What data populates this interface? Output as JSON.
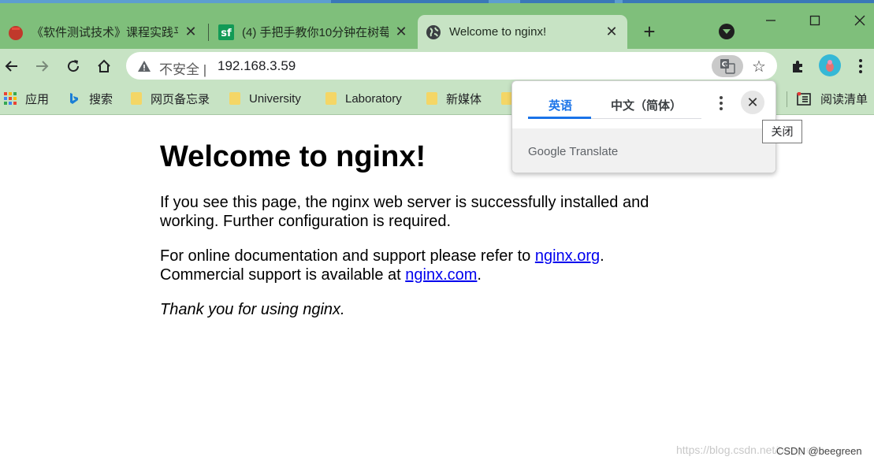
{
  "tabs": [
    {
      "title": "《软件测试技术》课程实践平",
      "favicon": "red-round-logo-icon",
      "active": false
    },
    {
      "title": "(4) 手把手教你10分钟在树莓",
      "favicon": "sf-logo-icon",
      "active": false
    },
    {
      "title": "Welcome to nginx!",
      "favicon": "globe-icon",
      "active": true
    }
  ],
  "address_bar": {
    "security_label": "不安全",
    "separator": "|",
    "url": "192.168.3.59"
  },
  "bookmarks": [
    {
      "label": "应用",
      "icon": "apps-grid-icon"
    },
    {
      "label": "搜索",
      "icon": "bing-logo-icon"
    },
    {
      "label": "网页备忘录",
      "icon": "folder-icon"
    },
    {
      "label": "University",
      "icon": "folder-icon"
    },
    {
      "label": "Laboratory",
      "icon": "folder-icon"
    },
    {
      "label": "新媒体",
      "icon": "folder-icon"
    },
    {
      "label": "阅读清单",
      "icon": "reading-list-icon"
    }
  ],
  "page": {
    "heading": "Welcome to nginx!",
    "para1": "If you see this page, the nginx web server is successfully installed and working. Further configuration is required.",
    "para2_prefix": "For online documentation and support please refer to ",
    "link1": "nginx.org",
    "para2_mid": ".",
    "para2_line2": "Commercial support is available at ",
    "link2": "nginx.com",
    "para2_end": ".",
    "thanks": "Thank you for using nginx."
  },
  "translate_popup": {
    "tab_source": "英语",
    "tab_target": "中文（简体）",
    "brand": "Google Translate",
    "close_tooltip": "关闭"
  },
  "watermark": "https://blog.csdn.net/beegreen",
  "credit": "CSDN @beegreen",
  "colors": {
    "tab_strip": "#7fbf7b",
    "toolbar": "#c7e3c4",
    "link": "#0000ee",
    "translate_accent": "#1a73e8"
  }
}
